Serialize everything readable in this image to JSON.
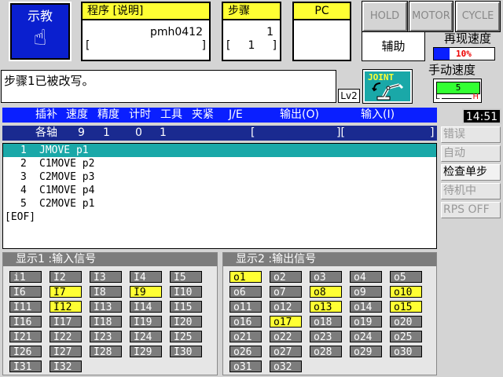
{
  "teach": {
    "label": "示教"
  },
  "program_box": {
    "header": "程序 [说明]",
    "value": "pmh0412",
    "bracket_left": "[",
    "bracket_right": "]"
  },
  "step_box": {
    "header": "步骤",
    "value": "1",
    "bracket_left": "[",
    "bracket_value": "1",
    "bracket_right": "]"
  },
  "pc_box": {
    "header": "PC"
  },
  "status_buttons": {
    "hold": "HOLD",
    "motor": "MOTOR",
    "cycle": "CYCLE"
  },
  "aux_button": "辅助",
  "replay_speed": {
    "label": "再现速度",
    "value": "10%"
  },
  "manual_speed": {
    "label": "手动速度",
    "value": "5",
    "low": "L",
    "high": "H"
  },
  "message": "步骤1已被改写。",
  "level": "Lv2",
  "joint_label": "JOINT",
  "clock": "14:51",
  "header_cols": {
    "interp": "插补",
    "speed": "速度",
    "precision": "精度",
    "timer": "计时",
    "tool": "工具",
    "clamp": "夹紧",
    "je": "J/E",
    "output": "输出(O)",
    "input": "输入(I)"
  },
  "axis_row": {
    "label": "各轴",
    "speed": "9",
    "precision": "1",
    "timer": "0",
    "tool": "1",
    "open1": "[",
    "mid": "][",
    "close": "]"
  },
  "program_lines": [
    {
      "num": "1",
      "text": "JMOVE p1"
    },
    {
      "num": "2",
      "text": "C1MOVE p2"
    },
    {
      "num": "3",
      "text": "C2MOVE p3"
    },
    {
      "num": "4",
      "text": "C1MOVE p4"
    },
    {
      "num": "5",
      "text": "C2MOVE p1"
    }
  ],
  "eof": "[EOF]",
  "side_menu": [
    {
      "label": "错误",
      "active": false
    },
    {
      "label": "自动",
      "active": false
    },
    {
      "label": "检查单步",
      "active": true
    },
    {
      "label": "待机中",
      "active": false
    },
    {
      "label": "RPS OFF",
      "active": false
    }
  ],
  "display1": {
    "title": "显示1 :输入信号",
    "signals": [
      "i1",
      "I2",
      "I3",
      "I4",
      "I5",
      "I6",
      "I7",
      "I8",
      "I9",
      "I10",
      "I11",
      "I12",
      "I13",
      "I14",
      "I15",
      "I16",
      "I17",
      "I18",
      "I19",
      "I20",
      "I21",
      "I22",
      "I23",
      "I24",
      "I25",
      "I26",
      "I27",
      "I28",
      "I29",
      "I30",
      "I31",
      "I32"
    ],
    "on": [
      "I7",
      "I9",
      "I12"
    ]
  },
  "display2": {
    "title": "显示2 :输出信号",
    "signals": [
      "o1",
      "o2",
      "o3",
      "o4",
      "o5",
      "o6",
      "o7",
      "o8",
      "o9",
      "o10",
      "o11",
      "o12",
      "o13",
      "o14",
      "o15",
      "o16",
      "o17",
      "o18",
      "o19",
      "o20",
      "o21",
      "o22",
      "o23",
      "o24",
      "o25",
      "o26",
      "o27",
      "o28",
      "o29",
      "o30",
      "o31",
      "o32"
    ],
    "on": [
      "o1",
      "o8",
      "o10",
      "o13",
      "o15",
      "o17"
    ]
  },
  "colors": {
    "blue": "#0a1fff",
    "yellow": "#ffff33",
    "teal": "#1aa8a8",
    "gray": "#7c7c7c"
  }
}
